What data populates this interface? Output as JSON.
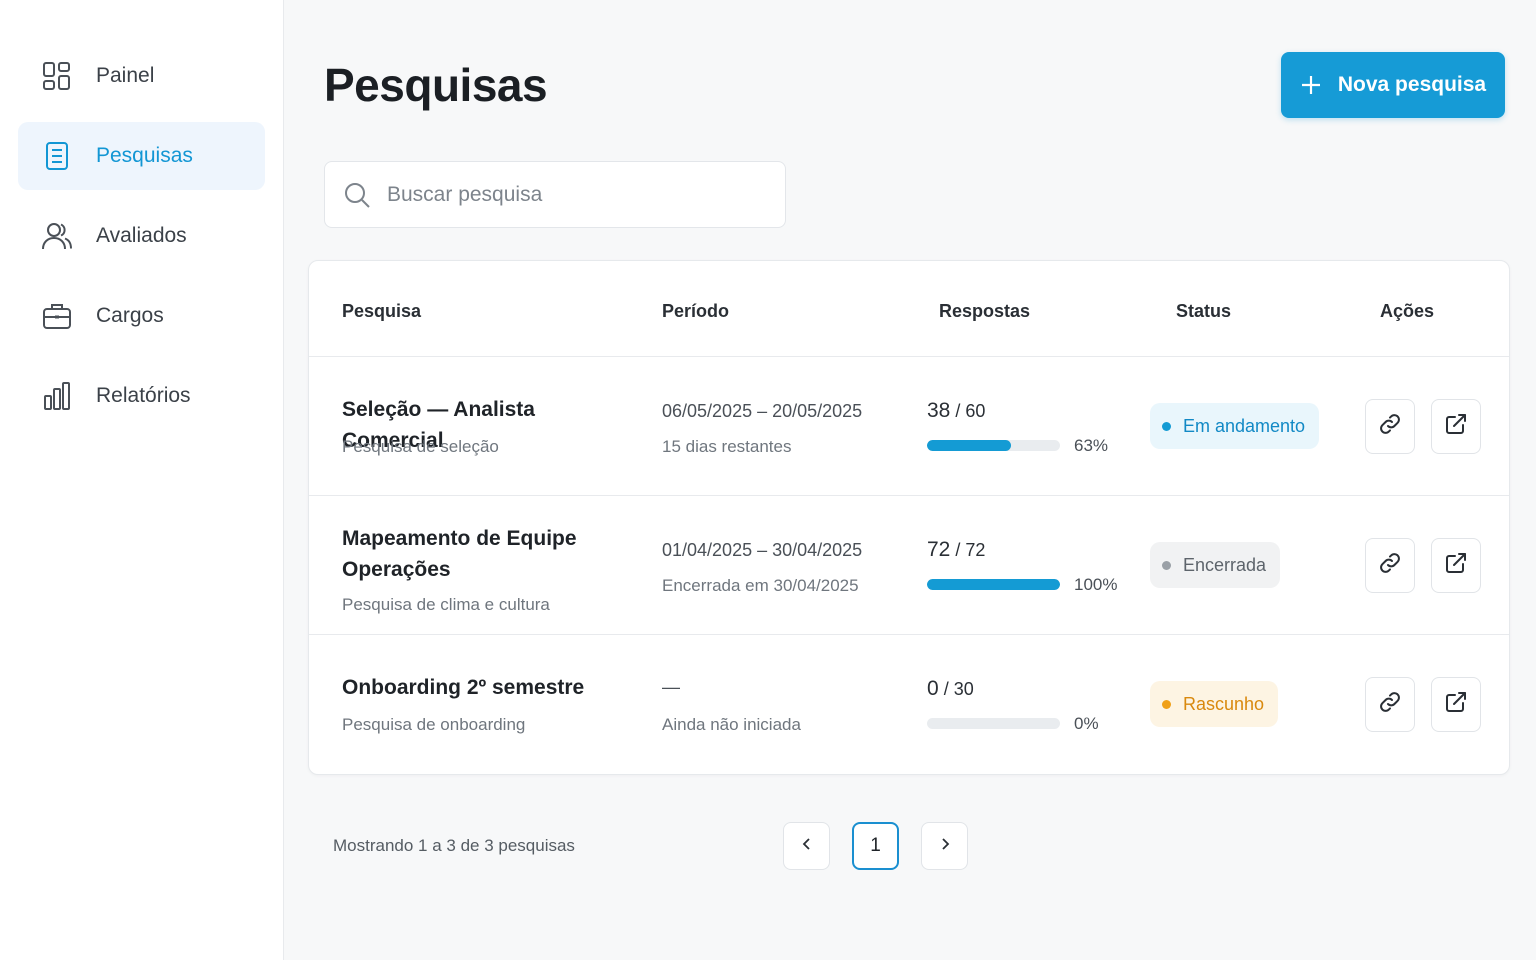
{
  "sidebar": {
    "items": [
      {
        "label": "Painel",
        "icon": "dashboard-grid-icon",
        "active": false
      },
      {
        "label": "Pesquisas",
        "icon": "document-list-icon",
        "active": true
      },
      {
        "label": "Avaliados",
        "icon": "users-icon",
        "active": false
      },
      {
        "label": "Cargos",
        "icon": "briefcase-icon",
        "active": false
      },
      {
        "label": "Relatórios",
        "icon": "bar-chart-icon",
        "active": false
      }
    ]
  },
  "header": {
    "title": "Pesquisas",
    "new_button_label": "Nova pesquisa"
  },
  "search": {
    "placeholder": "Buscar pesquisa",
    "value": ""
  },
  "table": {
    "columns": [
      "Pesquisa",
      "Período",
      "Respostas",
      "Status",
      "Ações"
    ],
    "rows": [
      {
        "title": "Seleção — Analista Comercial",
        "type": "Pesquisa de seleção",
        "period": "06/05/2025  –  20/05/2025",
        "period_note": "15 dias restantes",
        "responses": "38",
        "total": " / 60",
        "progress": 0.63,
        "percent": "63%",
        "status": "Em andamento",
        "status_kind": "active"
      },
      {
        "title": "Mapeamento de Equipe Operações",
        "type": "Pesquisa de clima e cultura",
        "period": "01/04/2025  –  30/04/2025",
        "period_note": "Encerrada em 30/04/2025",
        "responses": "72",
        "total": " / 72",
        "progress": 1.0,
        "percent": "100%",
        "status": "Encerrada",
        "status_kind": "closed"
      },
      {
        "title": "Onboarding 2º semestre",
        "type": "Pesquisa de onboarding",
        "period": "—",
        "period_note": "Ainda não iniciada",
        "responses": "0",
        "total": " / 30",
        "progress": 0.0,
        "percent": "0%",
        "status": "Rascunho",
        "status_kind": "draft"
      }
    ]
  },
  "pagination": {
    "info": "Mostrando 1 a 3 de 3 pesquisas",
    "current_page": "1",
    "prev_icon": "chevron-left-icon",
    "next_icon": "chevron-right-icon"
  },
  "colors": {
    "accent": "#169bd6",
    "active_nav_bg": "#eef5fd",
    "status_active": "#149bd4",
    "status_draft": "#f0a018",
    "status_closed": "#9aa0a6"
  }
}
